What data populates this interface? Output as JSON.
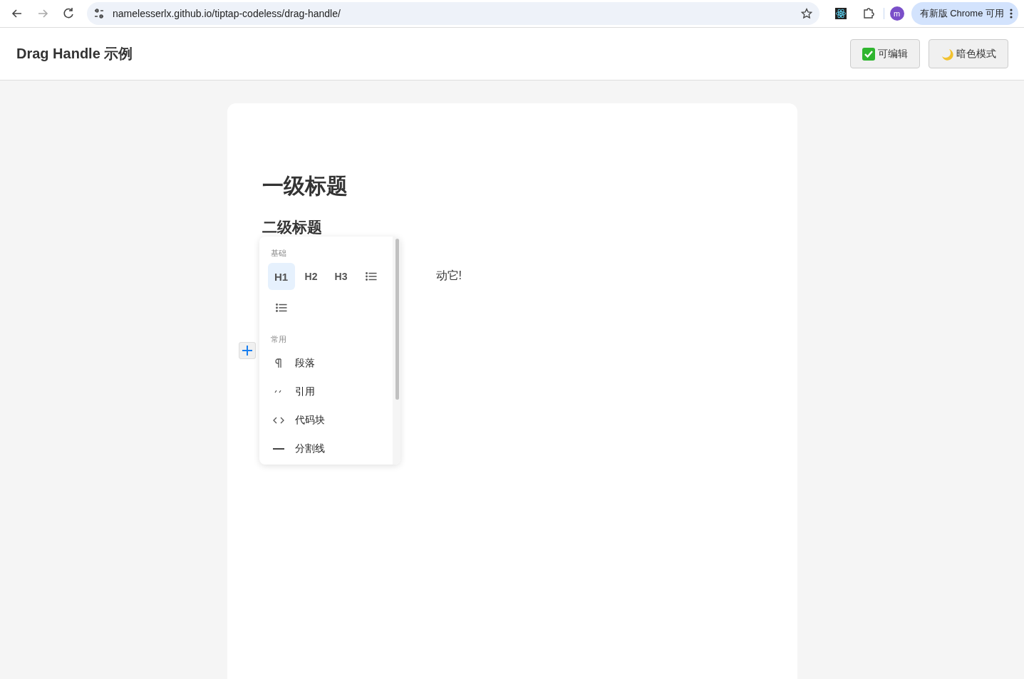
{
  "browser": {
    "url": "namelesserlx.github.io/tiptap-codeless/drag-handle/",
    "forward_disabled": true,
    "avatar": "m",
    "update": "有新版 Chrome 可用"
  },
  "header": {
    "title": "Drag Handle 示例",
    "buttons": [
      {
        "kind": "check",
        "label": "可编辑"
      },
      {
        "kind": "moon",
        "label": "暗色模式"
      }
    ]
  },
  "editor": {
    "heading1": "一级标题",
    "heading2": "二级标题",
    "paragraph": "动它!"
  },
  "menu": {
    "sections": [
      {
        "title": "基础",
        "kind": "grid",
        "items": [
          {
            "kind": "text",
            "label": "H1",
            "selected": true
          },
          {
            "kind": "text",
            "label": "H2",
            "selected": false
          },
          {
            "kind": "text",
            "label": "H3",
            "selected": false
          },
          {
            "kind": "list",
            "selected": false
          },
          {
            "kind": "list",
            "selected": false
          }
        ]
      },
      {
        "title": "常用",
        "kind": "rows",
        "items": [
          {
            "kind": "pilcrow",
            "label": "段落",
            "selected": false
          },
          {
            "kind": "quote",
            "label": "引用",
            "selected": false
          },
          {
            "kind": "code",
            "label": "代码块",
            "selected": false
          },
          {
            "kind": "rule",
            "label": "分割线",
            "selected": false
          }
        ]
      }
    ]
  }
}
